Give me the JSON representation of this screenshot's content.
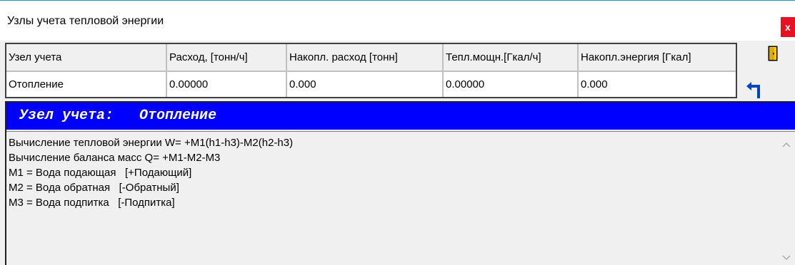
{
  "window": {
    "title": "Узлы учета тепловой энергии",
    "close_glyph": "x"
  },
  "table": {
    "columns": [
      "Узел учета",
      "Расход, [тонн/ч]",
      "Накопл. расход [тонн]",
      "Тепл.мощн.[Гкал/ч]",
      "Накопл.энергия [Гкал]"
    ],
    "rows": [
      [
        "Отопление",
        "0.00000",
        "0.000",
        "0.00000",
        "0.000"
      ]
    ]
  },
  "tools": {
    "exit_icon": "exit-door-icon",
    "back_icon": "return-arrow-icon",
    "exit_color": "#ffcc00",
    "back_color": "#0044cc"
  },
  "panel": {
    "header_label": "Узел учета:",
    "header_value": "Отопление",
    "header_color": "#0000ff",
    "lines": [
      "Вычисление тепловой энергии W= +M1(h1-h3)-M2(h2-h3)",
      "Вычисление баланса масс Q= +M1-M2-M3",
      "M1 = Вода подающая   [+Подающий]",
      "M2 = Вода обратная   [-Обратный]",
      "M3 = Вода подпитка   [-Подпитка]"
    ]
  }
}
